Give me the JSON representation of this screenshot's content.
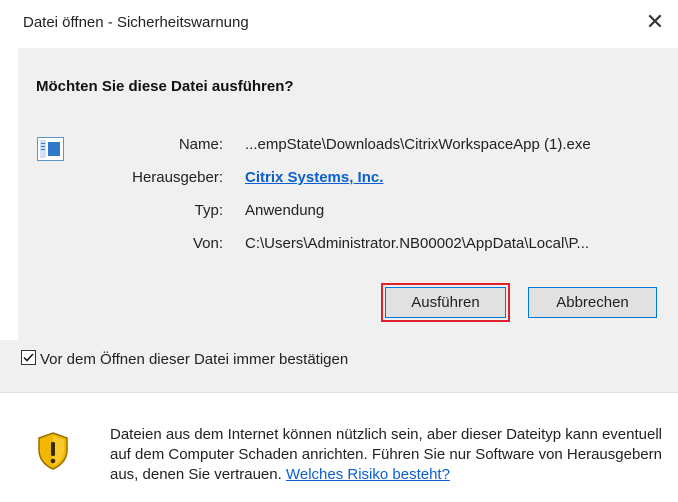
{
  "window": {
    "title": "Datei öffnen - Sicherheitswarnung",
    "close_glyph": "✕"
  },
  "question": "Möchten Sie diese Datei ausführen?",
  "file_icon": "application-window-icon",
  "details": [
    {
      "label": "Name:",
      "value": "...empState\\Downloads\\CitrixWorkspaceApp (1).exe"
    },
    {
      "label": "Herausgeber:",
      "value": "Citrix Systems, Inc."
    },
    {
      "label": "Typ:",
      "value": "Anwendung"
    },
    {
      "label": "Von:",
      "value": "C:\\Users\\Administrator.NB00002\\AppData\\Local\\P..."
    }
  ],
  "buttons": {
    "run": "Ausführen",
    "cancel": "Abbrechen"
  },
  "checkbox": {
    "label": "Vor dem Öffnen dieser Datei immer bestätigen",
    "checked": true
  },
  "warning": {
    "icon": "shield-warning-icon",
    "text": "Dateien aus dem Internet können nützlich sein, aber dieser Dateityp kann eventuell auf dem Computer Schaden anrichten. Führen Sie nur Software von Herausgebern aus, denen Sie vertrauen.",
    "link": "Welches Risiko besteht?"
  },
  "colors": {
    "link": "#0b5fcf",
    "highlight": "#e0202c",
    "focus": "#0078d7",
    "shield": "#e8a800"
  }
}
